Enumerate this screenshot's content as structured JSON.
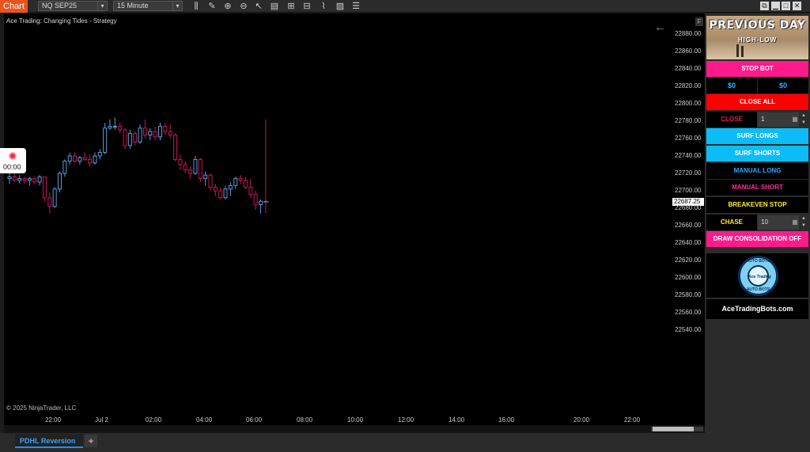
{
  "toolbar": {
    "app_title": "Chart",
    "instrument": "NQ SEP25",
    "timeframe": "15 Minute"
  },
  "chart": {
    "title": "Ace Trading: Changing Tides - Strategy",
    "copyright": "© 2025 NinjaTrader, LLC",
    "current_price": "22687.25",
    "f_label": "F",
    "recorder_time": "00:00",
    "colors": {
      "up": "#5b9bd5",
      "down": "#c2185b",
      "background": "#000000"
    }
  },
  "chart_data": {
    "type": "candlestick",
    "title": "Ace Trading: Changing Tides - Strategy",
    "x_tick_labels": [
      "22:00",
      "Jul 2",
      "02:00",
      "04:00",
      "06:00",
      "08:00",
      "10:00",
      "12:00",
      "14:00",
      "16:00",
      "20:00",
      "22:00"
    ],
    "y_tick_labels": [
      "22880.00",
      "22860.00",
      "22840.00",
      "22820.00",
      "22800.00",
      "22780.00",
      "22760.00",
      "22740.00",
      "22720.00",
      "22700.00",
      "22680.00",
      "22660.00",
      "22640.00",
      "22620.00",
      "22600.00",
      "22580.00",
      "22560.00",
      "22540.00"
    ],
    "ylim": [
      22530,
      22888
    ],
    "candles": [
      {
        "o": 22714,
        "h": 22720,
        "l": 22708,
        "c": 22716
      },
      {
        "o": 22716,
        "h": 22722,
        "l": 22710,
        "c": 22712
      },
      {
        "o": 22712,
        "h": 22718,
        "l": 22708,
        "c": 22714
      },
      {
        "o": 22714,
        "h": 22716,
        "l": 22708,
        "c": 22712
      },
      {
        "o": 22712,
        "h": 22716,
        "l": 22706,
        "c": 22714
      },
      {
        "o": 22714,
        "h": 22716,
        "l": 22708,
        "c": 22710
      },
      {
        "o": 22710,
        "h": 22718,
        "l": 22706,
        "c": 22716
      },
      {
        "o": 22716,
        "h": 22716,
        "l": 22688,
        "c": 22692
      },
      {
        "o": 22692,
        "h": 22698,
        "l": 22674,
        "c": 22682
      },
      {
        "o": 22682,
        "h": 22704,
        "l": 22680,
        "c": 22702
      },
      {
        "o": 22702,
        "h": 22722,
        "l": 22698,
        "c": 22720
      },
      {
        "o": 22720,
        "h": 22736,
        "l": 22716,
        "c": 22734
      },
      {
        "o": 22734,
        "h": 22744,
        "l": 22730,
        "c": 22740
      },
      {
        "o": 22740,
        "h": 22744,
        "l": 22732,
        "c": 22734
      },
      {
        "o": 22734,
        "h": 22740,
        "l": 22730,
        "c": 22738
      },
      {
        "o": 22738,
        "h": 22744,
        "l": 22734,
        "c": 22736
      },
      {
        "o": 22736,
        "h": 22742,
        "l": 22728,
        "c": 22732
      },
      {
        "o": 22732,
        "h": 22744,
        "l": 22730,
        "c": 22740
      },
      {
        "o": 22740,
        "h": 22748,
        "l": 22736,
        "c": 22744
      },
      {
        "o": 22744,
        "h": 22778,
        "l": 22742,
        "c": 22772
      },
      {
        "o": 22772,
        "h": 22782,
        "l": 22770,
        "c": 22774
      },
      {
        "o": 22774,
        "h": 22784,
        "l": 22770,
        "c": 22774
      },
      {
        "o": 22774,
        "h": 22778,
        "l": 22766,
        "c": 22770
      },
      {
        "o": 22770,
        "h": 22772,
        "l": 22748,
        "c": 22752
      },
      {
        "o": 22752,
        "h": 22770,
        "l": 22748,
        "c": 22766
      },
      {
        "o": 22766,
        "h": 22768,
        "l": 22752,
        "c": 22756
      },
      {
        "o": 22756,
        "h": 22776,
        "l": 22754,
        "c": 22772
      },
      {
        "o": 22772,
        "h": 22782,
        "l": 22760,
        "c": 22764
      },
      {
        "o": 22764,
        "h": 22772,
        "l": 22758,
        "c": 22768
      },
      {
        "o": 22768,
        "h": 22774,
        "l": 22758,
        "c": 22762
      },
      {
        "o": 22762,
        "h": 22778,
        "l": 22758,
        "c": 22774
      },
      {
        "o": 22774,
        "h": 22778,
        "l": 22764,
        "c": 22768
      },
      {
        "o": 22768,
        "h": 22776,
        "l": 22760,
        "c": 22764
      },
      {
        "o": 22764,
        "h": 22766,
        "l": 22734,
        "c": 22736
      },
      {
        "o": 22736,
        "h": 22742,
        "l": 22724,
        "c": 22730
      },
      {
        "o": 22730,
        "h": 22734,
        "l": 22720,
        "c": 22724
      },
      {
        "o": 22724,
        "h": 22728,
        "l": 22714,
        "c": 22720
      },
      {
        "o": 22720,
        "h": 22740,
        "l": 22718,
        "c": 22736
      },
      {
        "o": 22736,
        "h": 22738,
        "l": 22710,
        "c": 22714
      },
      {
        "o": 22714,
        "h": 22722,
        "l": 22706,
        "c": 22718
      },
      {
        "o": 22718,
        "h": 22720,
        "l": 22700,
        "c": 22704
      },
      {
        "o": 22704,
        "h": 22708,
        "l": 22694,
        "c": 22700
      },
      {
        "o": 22700,
        "h": 22704,
        "l": 22690,
        "c": 22692
      },
      {
        "o": 22692,
        "h": 22706,
        "l": 22690,
        "c": 22702
      },
      {
        "o": 22702,
        "h": 22710,
        "l": 22694,
        "c": 22706
      },
      {
        "o": 22706,
        "h": 22716,
        "l": 22702,
        "c": 22714
      },
      {
        "o": 22714,
        "h": 22718,
        "l": 22708,
        "c": 22712
      },
      {
        "o": 22712,
        "h": 22716,
        "l": 22702,
        "c": 22704
      },
      {
        "o": 22704,
        "h": 22714,
        "l": 22692,
        "c": 22696
      },
      {
        "o": 22696,
        "h": 22700,
        "l": 22678,
        "c": 22684
      },
      {
        "o": 22684,
        "h": 22690,
        "l": 22674,
        "c": 22688
      },
      {
        "o": 22688,
        "h": 22782,
        "l": 22674,
        "c": 22687.25
      }
    ]
  },
  "panel": {
    "banner_title": "PREVIOUS DAY",
    "banner_sub": "HIGH-LOW",
    "stop_bot": "STOP BOT",
    "pnl_left": "$0",
    "pnl_right": "$0",
    "close_all": "CLOSE ALL",
    "close_label": "CLOSE",
    "close_qty": "1",
    "surf_longs": "SURF LONGS",
    "surf_shorts": "SURF SHORTS",
    "manual_long": "MANUAL LONG",
    "manual_short": "MANUAL SHORT",
    "breakeven_stop": "BREAKEVEN STOP",
    "chase_label": "CHASE",
    "chase_qty": "10",
    "draw_consolidation": "DRAW CONSOLIDATION OFF",
    "logo_top": "AUTO BOTS",
    "logo_mid": "Ace Trading",
    "logo_bottom": "AUTO BOTS",
    "site": "AceTradingBots.com"
  },
  "tabs": {
    "active": "PDHL Reversion",
    "add": "+"
  }
}
